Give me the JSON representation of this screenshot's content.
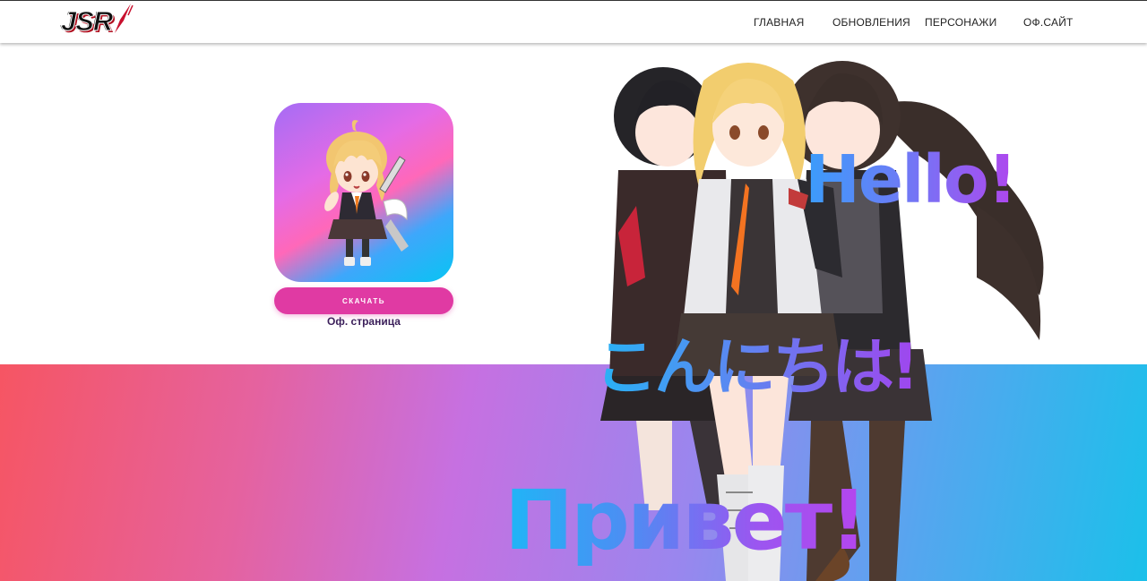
{
  "header": {
    "logo_text": "JSR",
    "nav": [
      {
        "label": "ГЛАВНАЯ"
      },
      {
        "label": "ОБНОВЛЕНИЯ"
      },
      {
        "label": "ПЕРСОНАЖИ"
      },
      {
        "label": "ОФ.САЙТ"
      }
    ]
  },
  "app": {
    "icon": "chibi-character-app-icon",
    "download_label": "СКАЧАТЬ",
    "official_page_label": "Оф. страница"
  },
  "hero": {
    "art": "three-anime-girls-illustration",
    "greetings": {
      "hello": "Hello!",
      "konnichiwa": "こんにちは!",
      "privet": "Привет!"
    }
  },
  "colors": {
    "button": "#e03aa3",
    "band_start": "#f65563",
    "band_end": "#1bc0ea",
    "link": "#3b1f5a"
  }
}
